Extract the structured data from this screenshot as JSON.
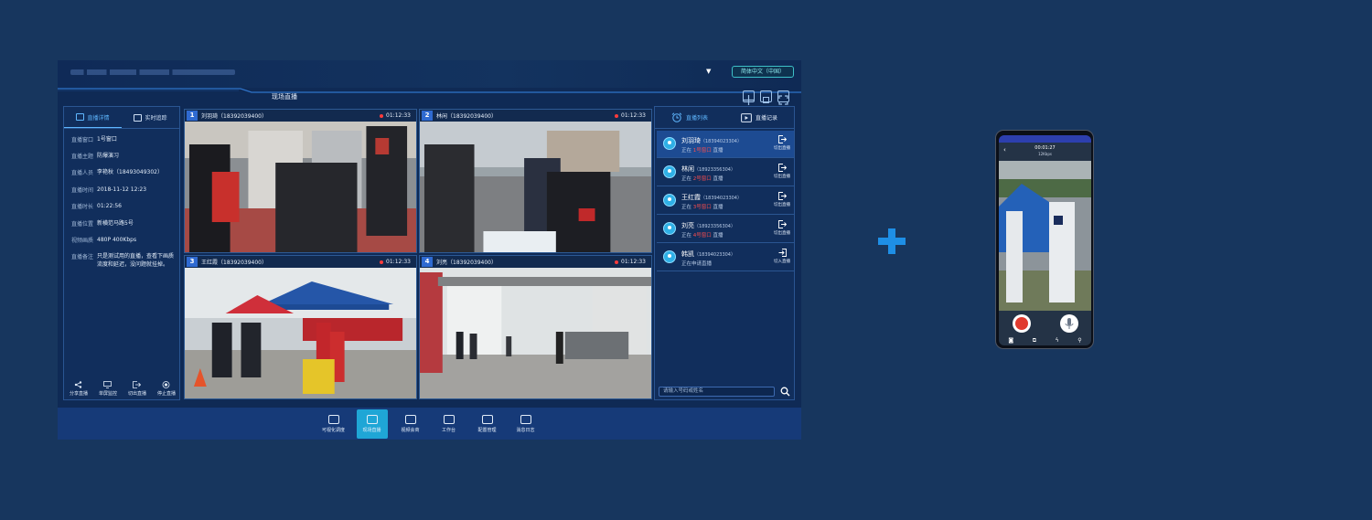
{
  "header": {
    "language": "简体中文（中国）",
    "section_title": "现场直播"
  },
  "left_panel": {
    "tabs": [
      {
        "label": "直播详情",
        "active": true
      },
      {
        "label": "实时追踪",
        "active": false
      }
    ],
    "details": [
      {
        "key": "直播窗口",
        "value": "1号窗口"
      },
      {
        "key": "直播主题",
        "value": "防爆演习"
      },
      {
        "key": "直播人员",
        "value": "李艳秋（18493049302）"
      },
      {
        "key": "直播时间",
        "value": "2018-11-12 12:23"
      },
      {
        "key": "直播时长",
        "value": "01:22:56"
      },
      {
        "key": "直播位置",
        "value": "新横范马路5号"
      },
      {
        "key": "视频画质",
        "value": "480P  400Kbps"
      },
      {
        "key": "直播备注",
        "value": "只是测试用的直播，查看下画质流度和延迟，没问题就挂掉。"
      }
    ],
    "actions": [
      "分享直播",
      "单屏监控",
      "切出直播",
      "停止直播"
    ]
  },
  "video_grid": [
    {
      "num": "1",
      "title": "刘羽琦（18392039400）",
      "time": "01:12:33"
    },
    {
      "num": "2",
      "title": "林闲（18392039400）",
      "time": "01:12:33"
    },
    {
      "num": "3",
      "title": "王红霞（18392039400）",
      "time": "01:12:33"
    },
    {
      "num": "4",
      "title": "刘亮（18392039400）",
      "time": "01:12:33"
    }
  ],
  "right_panel": {
    "tabs": [
      {
        "label": "直播列表",
        "active": true
      },
      {
        "label": "直播记录",
        "active": false
      }
    ],
    "list": [
      {
        "name": "刘羽琦",
        "phone": "（18394023304）",
        "status_prefix": "正在",
        "window": "1号窗口",
        "status_suffix": "直播",
        "action": "切出直播"
      },
      {
        "name": "林闲",
        "phone": "（18923356304）",
        "status_prefix": "正在",
        "window": "2号窗口",
        "status_suffix": "直播",
        "action": "切出直播"
      },
      {
        "name": "王红霞",
        "phone": "（18394023304）",
        "status_prefix": "正在",
        "window": "3号窗口",
        "status_suffix": "直播",
        "action": "切出直播"
      },
      {
        "name": "刘亮",
        "phone": "（18923356304）",
        "status_prefix": "正在",
        "window": "4号窗口",
        "status_suffix": "直播",
        "action": "切出直播"
      },
      {
        "name": "韩凯",
        "phone": "（18394023304）",
        "status_prefix": "正在申请直播",
        "window": "",
        "status_suffix": "",
        "action": "切入直播"
      }
    ],
    "search_placeholder": "请输入号码或姓名"
  },
  "bottom_nav": [
    {
      "label": "可视化调度",
      "active": false
    },
    {
      "label": "现场直播",
      "active": true
    },
    {
      "label": "视频会商",
      "active": false
    },
    {
      "label": "工作台",
      "active": false
    },
    {
      "label": "配置管理",
      "active": false
    },
    {
      "label": "消息日志",
      "active": false
    }
  ],
  "phone": {
    "timer": "00:01:27",
    "subtitle": "12Kbps"
  },
  "colors": {
    "background": "#17365e",
    "accent": "#1fa6d6",
    "live_red": "#ff4d4d",
    "plus": "#1e8fe6"
  }
}
